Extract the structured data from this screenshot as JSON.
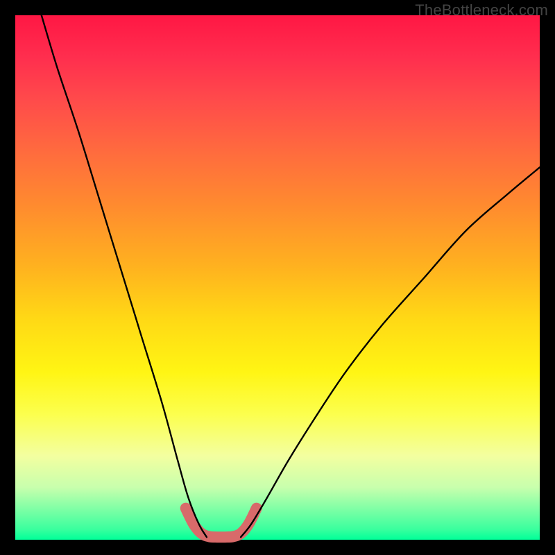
{
  "watermark": "TheBottleneck.com",
  "chart_data": {
    "type": "line",
    "title": "",
    "xlabel": "",
    "ylabel": "",
    "xlim": [
      0,
      100
    ],
    "ylim": [
      0,
      100
    ],
    "grid": false,
    "legend": false,
    "series": [
      {
        "name": "left-curve",
        "x": [
          5,
          8,
          12,
          16,
          20,
          24,
          28,
          31,
          33,
          35,
          36.5
        ],
        "values": [
          100,
          90,
          78,
          65,
          52,
          39,
          26,
          15,
          8,
          3,
          0.5
        ]
      },
      {
        "name": "right-curve",
        "x": [
          43,
          45,
          48,
          52,
          57,
          63,
          70,
          78,
          86,
          94,
          100
        ],
        "values": [
          0.5,
          3,
          8,
          15,
          23,
          32,
          41,
          50,
          59,
          66,
          71
        ]
      },
      {
        "name": "valley-highlight",
        "x": [
          32.5,
          34,
          35.5,
          37,
          38.5,
          40,
          41.5,
          43,
          44.5,
          46
        ],
        "values": [
          6,
          3,
          1.2,
          0.6,
          0.5,
          0.5,
          0.6,
          1.2,
          3,
          6
        ]
      }
    ],
    "gradient_stops": [
      {
        "pos": 0.0,
        "color": "#ff1744"
      },
      {
        "pos": 0.08,
        "color": "#ff2e4e"
      },
      {
        "pos": 0.16,
        "color": "#ff4a4b"
      },
      {
        "pos": 0.26,
        "color": "#ff6b3e"
      },
      {
        "pos": 0.36,
        "color": "#ff8a2f"
      },
      {
        "pos": 0.48,
        "color": "#ffb21f"
      },
      {
        "pos": 0.58,
        "color": "#ffd915"
      },
      {
        "pos": 0.68,
        "color": "#fff514"
      },
      {
        "pos": 0.76,
        "color": "#fcff4d"
      },
      {
        "pos": 0.84,
        "color": "#f3ffa0"
      },
      {
        "pos": 0.9,
        "color": "#c8ffad"
      },
      {
        "pos": 0.98,
        "color": "#3aff9e"
      },
      {
        "pos": 1.0,
        "color": "#00ff99"
      }
    ]
  }
}
